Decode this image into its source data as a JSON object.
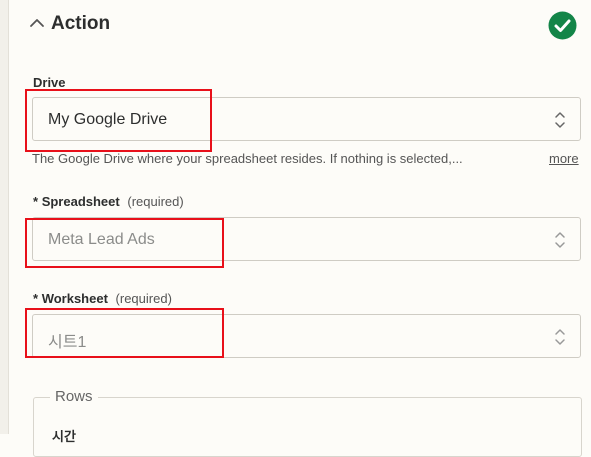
{
  "section": {
    "title": "Action",
    "status_color": "#138548"
  },
  "fields": {
    "drive": {
      "label": "Drive",
      "value": "My Google Drive",
      "help_text": "The Google Drive where your spreadsheet resides. If nothing is selected,...",
      "more_link": "more"
    },
    "spreadsheet": {
      "required_mark": "*",
      "label": "Spreadsheet",
      "required_text": "(required)",
      "value": "Meta Lead Ads"
    },
    "worksheet": {
      "required_mark": "*",
      "label": "Worksheet",
      "required_text": "(required)",
      "value": "시트1"
    }
  },
  "rows": {
    "legend": "Rows",
    "first_item": "시간"
  },
  "colors": {
    "highlight": "#e8101a",
    "background": "#fdfcf8"
  }
}
